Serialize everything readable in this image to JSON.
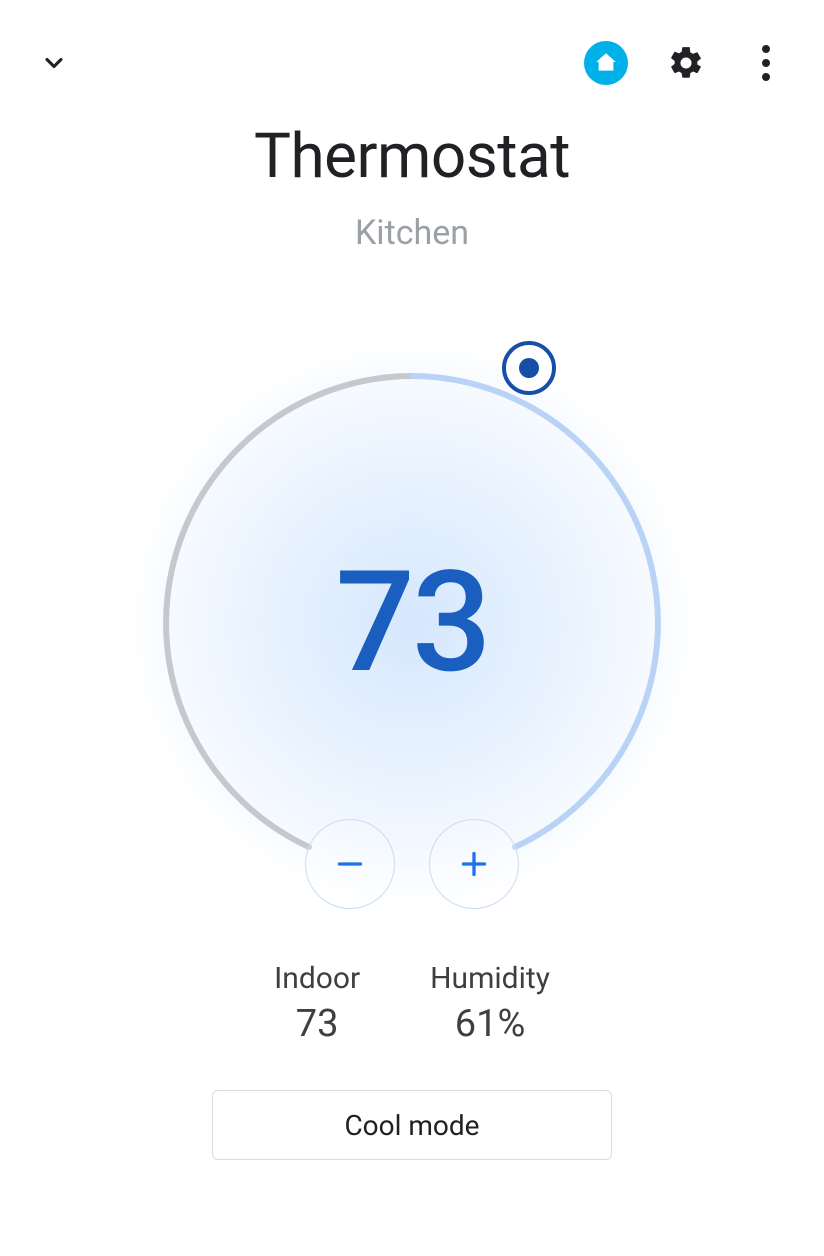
{
  "header": {
    "title": "Thermostat",
    "subtitle": "Kitchen"
  },
  "dial": {
    "set_temperature": "73"
  },
  "readings": {
    "indoor_label": "Indoor",
    "indoor_value": "73",
    "humidity_label": "Humidity",
    "humidity_value": "61%"
  },
  "mode_button": "Cool mode",
  "colors": {
    "accent_blue": "#1a73e8",
    "home_icon_bg": "#00b0e8",
    "dial_active": "#b9d3f7",
    "dial_inactive": "#c5c8cc"
  }
}
